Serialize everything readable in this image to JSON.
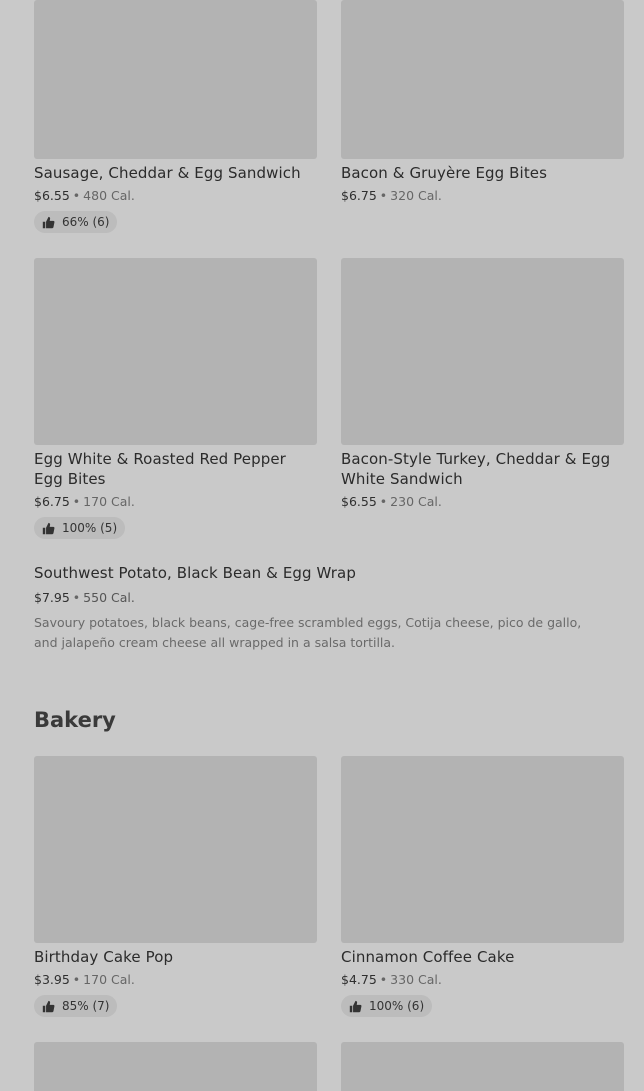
{
  "breakfast_items": [
    {
      "name": "Sausage, Cheddar & Egg Sandwich",
      "price": "$6.55",
      "calories": "480 Cal.",
      "rating": "66% (6)"
    },
    {
      "name": "Bacon & Gruyère Egg Bites",
      "price": "$6.75",
      "calories": "320 Cal.",
      "rating": ""
    },
    {
      "name": "Egg White & Roasted Red Pepper Egg Bites",
      "price": "$6.75",
      "calories": "170 Cal.",
      "rating": "100% (5)"
    },
    {
      "name": "Bacon-Style Turkey, Cheddar & Egg White Sandwich",
      "price": "$6.55",
      "calories": "230 Cal.",
      "rating": ""
    }
  ],
  "featured_item": {
    "name": "Southwest Potato, Black Bean & Egg Wrap",
    "price": "$7.95",
    "calories": "550 Cal.",
    "description": "Savoury potatoes, black beans, cage-free scrambled eggs, Cotija cheese, pico de gallo, and jalapeño cream cheese all wrapped in a salsa tortilla."
  },
  "bakery": {
    "title": "Bakery",
    "items": [
      {
        "name": "Birthday Cake Pop",
        "price": "$3.95",
        "calories": "170 Cal.",
        "rating": "85% (7)"
      },
      {
        "name": "Cinnamon Coffee Cake",
        "price": "$4.75",
        "calories": "330 Cal.",
        "rating": "100% (6)"
      }
    ]
  },
  "separator": "•",
  "icons": {
    "rating": "thumbs-up-icon"
  },
  "colors": {
    "overlay_background": "#c9c9c9",
    "image_placeholder": "#b3b3b3",
    "rating_pill": "#bcbcbc"
  }
}
